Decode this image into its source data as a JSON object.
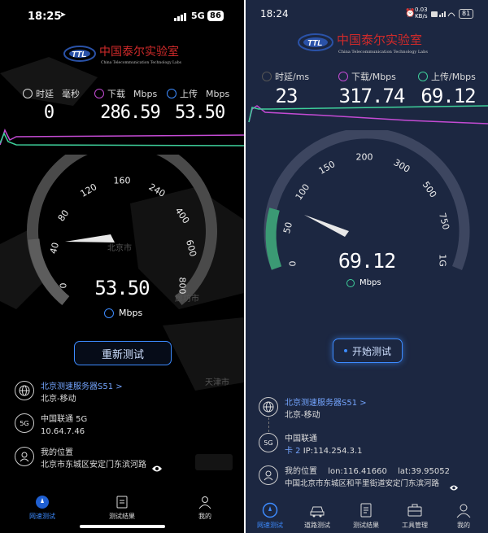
{
  "left_phone": {
    "status": {
      "time": "18:25",
      "network": "5G",
      "battery": "86"
    },
    "logo": {
      "brand_cn": "中国泰尔实验室",
      "brand_en": "China Telecommunication Technology Labs",
      "mark": "TTL"
    },
    "metrics": {
      "latency": {
        "label": "时延",
        "unit": "毫秒",
        "value": "0"
      },
      "download": {
        "label": "下载",
        "unit": "Mbps",
        "value": "286.59"
      },
      "upload": {
        "label": "上传",
        "unit": "Mbps",
        "value": "53.50"
      }
    },
    "gauge": {
      "ticks": [
        "0",
        "40",
        "80",
        "120",
        "160",
        "240",
        "400",
        "600",
        "800"
      ],
      "value": "53.50",
      "unit": "Mbps"
    },
    "map_labels": {
      "city1": "北京市",
      "city2": "廊坊市",
      "city3": "天津市"
    },
    "retest_button": "重新测试",
    "server": {
      "name": "北京测速服务器S51",
      "chevron": ">",
      "subtitle": "北京-移动"
    },
    "carrier": {
      "badge": "5G",
      "name": "中国联通 5G",
      "ip": "10.64.7.46"
    },
    "location": {
      "title": "我的位置",
      "address": "北京市东城区安定门东滨河路"
    },
    "tabs": [
      {
        "label": "网速测试",
        "icon": "speed-icon",
        "active": true
      },
      {
        "label": "测试结果",
        "icon": "results-icon",
        "active": false
      },
      {
        "label": "我的",
        "icon": "profile-icon",
        "active": false
      }
    ]
  },
  "right_phone": {
    "status": {
      "time": "18:24",
      "speed": "0.03",
      "speed_unit": "KB/s",
      "battery": "81"
    },
    "logo": {
      "brand_cn": "中国泰尔实验室",
      "brand_en": "China Telecommunication Technology Labs",
      "mark": "TTL"
    },
    "metrics": {
      "latency": {
        "label": "时延/ms",
        "value": "23"
      },
      "download": {
        "label": "下载/Mbps",
        "value": "317.74"
      },
      "upload": {
        "label": "上传/Mbps",
        "value": "69.12"
      }
    },
    "gauge": {
      "ticks": [
        "0",
        "50",
        "100",
        "150",
        "200",
        "300",
        "500",
        "750",
        "1G"
      ],
      "value": "69.12",
      "unit": "Mbps"
    },
    "start_button": "开始测试",
    "server": {
      "name": "北京测速服务器S51",
      "chevron": ">",
      "subtitle": "北京-移动"
    },
    "carrier": {
      "badge": "5G",
      "name": "中国联通",
      "sim": "卡 2",
      "ip": "IP:114.254.3.1"
    },
    "location": {
      "title": "我的位置",
      "lon": "lon:116.41660",
      "lat": "lat:39.95052",
      "address": "中国北京市东城区和平里街道安定门东滨河路"
    },
    "tabs": [
      {
        "label": "网速测试",
        "icon": "speed-icon",
        "active": true
      },
      {
        "label": "道路测试",
        "icon": "car-icon",
        "active": false
      },
      {
        "label": "测试结果",
        "icon": "results-icon",
        "active": false
      },
      {
        "label": "工具管理",
        "icon": "toolbox-icon",
        "active": false
      },
      {
        "label": "我的",
        "icon": "profile-icon",
        "active": false
      }
    ]
  },
  "colors": {
    "download": "#c44bd4",
    "upload": "#3ed09b",
    "accent": "#3d8bff",
    "gauge_track": "#4a4a4a",
    "gauge_fill": "#3b9a74"
  }
}
